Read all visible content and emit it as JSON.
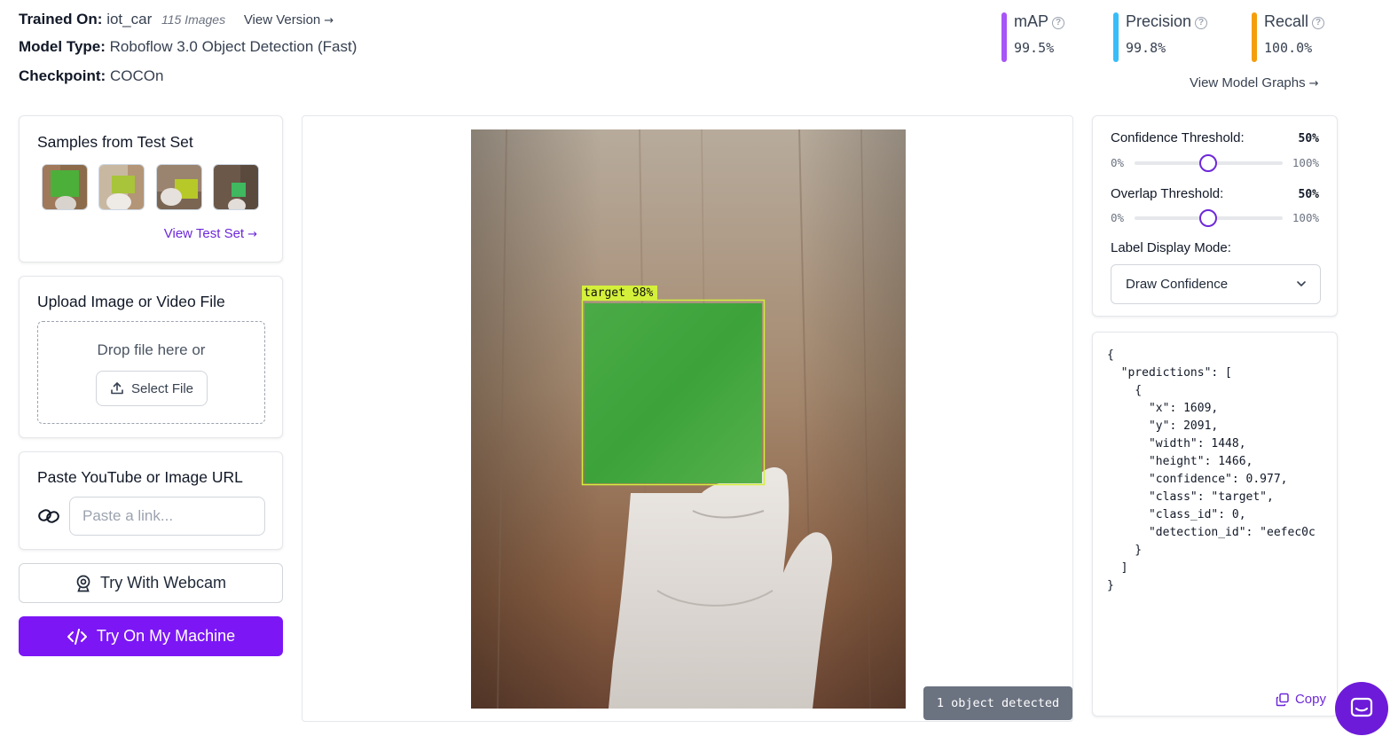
{
  "model": {
    "trained_on_label": "Trained On:",
    "trained_on_value": "iot_car",
    "images_count": "115 Images",
    "view_version": "View Version",
    "model_type_label": "Model Type:",
    "model_type_value": "Roboflow 3.0 Object Detection (Fast)",
    "checkpoint_label": "Checkpoint:",
    "checkpoint_value": "COCOn"
  },
  "metrics": [
    {
      "label": "mAP",
      "value": "99.5%",
      "color": "#a855f7"
    },
    {
      "label": "Precision",
      "value": "99.8%",
      "color": "#38bdf8"
    },
    {
      "label": "Recall",
      "value": "100.0%",
      "color": "#f59e0b"
    }
  ],
  "view_graphs": "View Model Graphs",
  "samples": {
    "title": "Samples from Test Set",
    "link": "View Test Set"
  },
  "upload": {
    "title": "Upload Image or Video File",
    "drop_text": "Drop file here or",
    "select_button": "Select File"
  },
  "url": {
    "title": "Paste YouTube or Image URL",
    "placeholder": "Paste a link..."
  },
  "buttons": {
    "webcam": "Try With Webcam",
    "machine": "Try On My Machine"
  },
  "detection": {
    "box_label": "target 98%",
    "status": "1 object detected",
    "box_color": "#d4f03a"
  },
  "controls": {
    "confidence_label": "Confidence Threshold:",
    "confidence_value": "50%",
    "overlap_label": "Overlap Threshold:",
    "overlap_value": "50%",
    "range_min": "0%",
    "range_max": "100%",
    "label_mode_label": "Label Display Mode:",
    "label_mode_value": "Draw Confidence"
  },
  "json_output": {
    "lines": [
      "{",
      "  \"predictions\": [",
      "    {",
      "      \"x\": 1609,",
      "      \"y\": 2091,",
      "      \"width\": 1448,",
      "      \"height\": 1466,",
      "      \"confidence\": 0.977,",
      "      \"class\": \"target\",",
      "      \"class_id\": 0,",
      "      \"detection_id\": \"eefec0c",
      "    }",
      "  ]",
      "}"
    ],
    "copy_label": "Copy"
  },
  "accent_color": "#7c16f5"
}
